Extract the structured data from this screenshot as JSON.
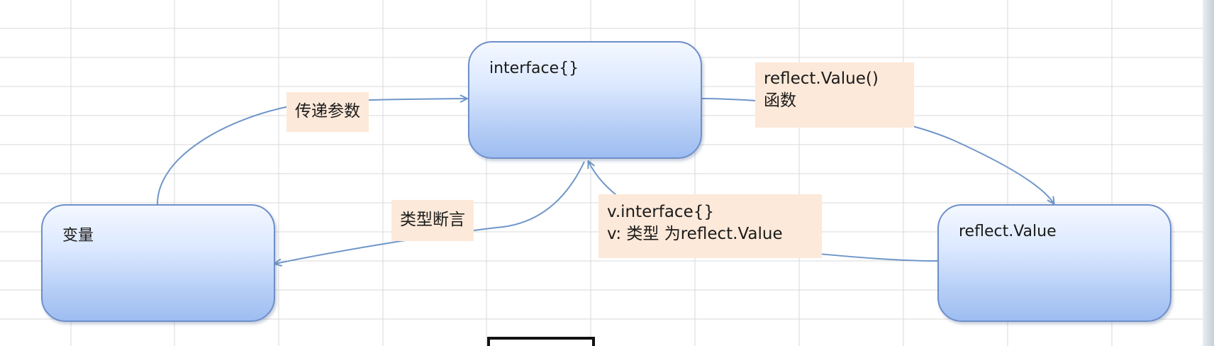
{
  "nodes": {
    "interface": {
      "label": "interface{}"
    },
    "variable": {
      "label": "变量"
    },
    "reflect_value": {
      "label": "reflect.Value"
    }
  },
  "edges": {
    "pass_param": {
      "label": "传递参数"
    },
    "type_assert": {
      "label": "类型断言"
    },
    "reflect_value_func": {
      "line1": "reflect.Value()",
      "line2": "函数"
    },
    "v_interface": {
      "line1": "v.interface{}",
      "line2": "v: 类型 为reflect.Value"
    }
  },
  "colors": {
    "node_border": "#6f8fc9",
    "node_fill_top": "#f4f8ff",
    "node_fill_bottom": "#9dbdf1",
    "label_fill": "#fde9d9",
    "connector": "#6f96c8",
    "grid": "#d9d9d9"
  }
}
